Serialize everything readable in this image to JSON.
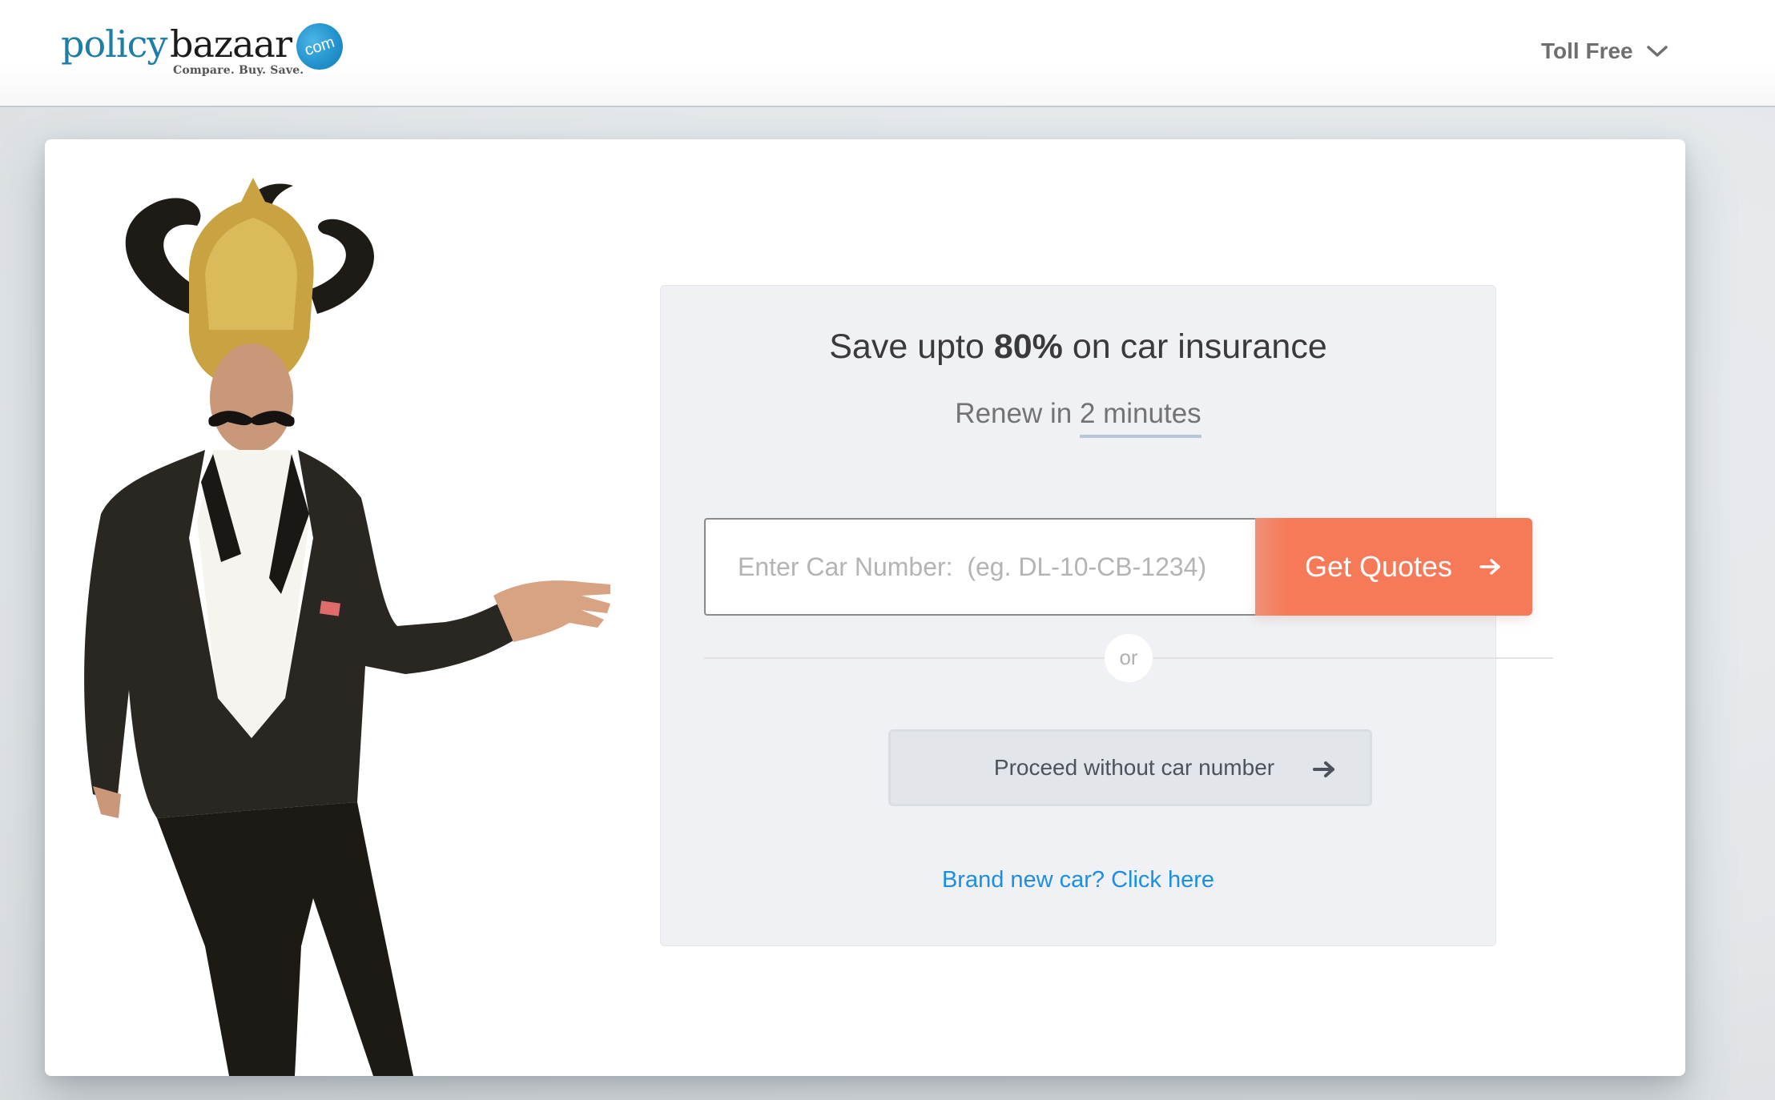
{
  "header": {
    "logo": {
      "word1": "policy",
      "word2": "bazaar",
      "badge": "com",
      "tagline": "Compare. Buy. Save."
    },
    "toll_free_label": "Toll Free",
    "toll_free_icon": "chevron-down-icon"
  },
  "hero": {
    "image_alt": "Brand ambassador in suit with golden crown and horns pointing to the form"
  },
  "quote_panel": {
    "headline_prefix": "Save upto ",
    "headline_emphasis": "80%",
    "headline_suffix": " on car insurance",
    "subline_prefix": "Renew in ",
    "subline_highlight": "2 minutes",
    "car_number_input": {
      "value": "",
      "placeholder": "Enter Car Number:  (eg. DL-10-CB-1234)"
    },
    "get_quotes_label": "Get Quotes",
    "get_quotes_icon": "arrow-right-icon",
    "or_label": "or",
    "proceed_label": "Proceed without car number",
    "proceed_icon": "arrow-right-icon",
    "brand_new_link": "Brand new car? Click here"
  },
  "colors": {
    "brand_blue": "#1d7ea8",
    "cta_orange": "#f77a58",
    "link_blue": "#1b8fe6",
    "panel_bg": "#eff1f5"
  }
}
